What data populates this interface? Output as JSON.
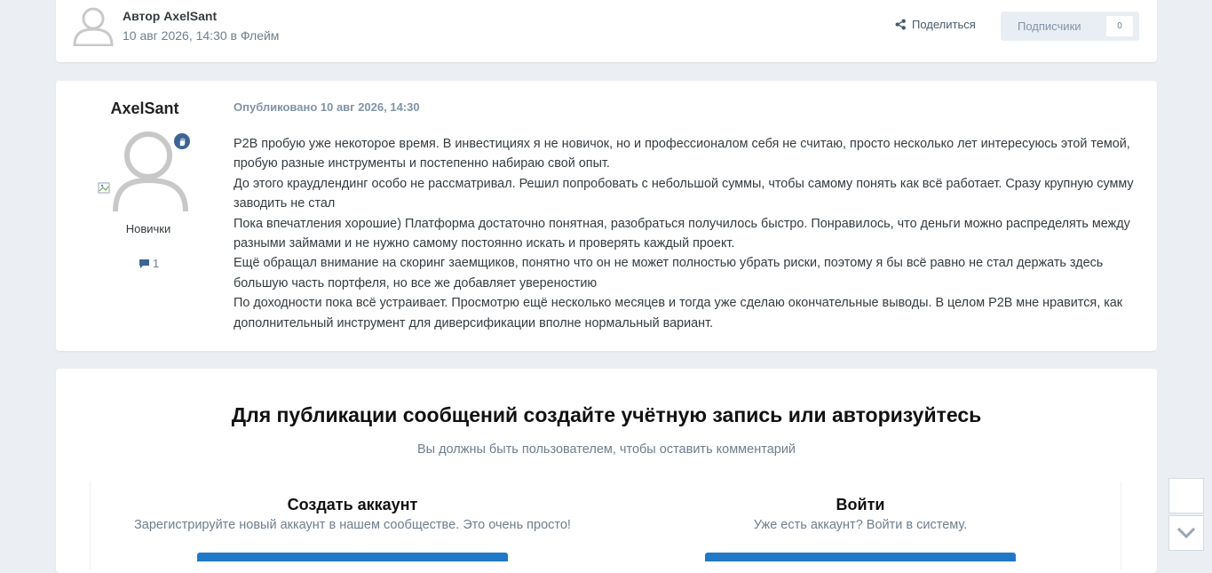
{
  "header": {
    "author_label": "Автор AxelSant",
    "meta": "10 авг 2026, 14:30 в Флейм",
    "share_label": "Поделиться",
    "follow_label": "Подписчики",
    "follow_count": "0",
    "icons": [
      "user-avatar-icon",
      "share-icon"
    ]
  },
  "post": {
    "username": "AxelSant",
    "rank": "Новички",
    "post_count": "1",
    "published": "Опубликовано 10 авг 2026, 14:30",
    "paragraphs": [
      "P2B пробую уже некоторое время. В инвестициях я не новичок, но и профессионалом себя не считаю, просто несколько лет интересуюсь этой темой, пробую разные инструменты и постепенно набираю свой опыт.",
      "До этого краудлендинг особо не рассматривал. Решил попробовать с небольшой суммы, чтобы самому понять как всё работает. Сразу крупную сумму заводить не стал",
      "Пока впечатления хорошие) Платформа достаточно понятная, разобраться получилось быстро. Понравилось, что деньги можно распределять между разными займами и не нужно самому постоянно искать и проверять каждый проект.",
      "Ещё обращал внимание на скоринг заемщиков, понятно что он не может полностью убрать риски, поэтому я бы всё равно не стал держать здесь большую часть портфеля, но все же добавляет увереностию",
      "По доходности пока всё устраивает. Просмотрю ещё несколько месяцев и тогда уже сделаю окончательные выводы. В целом P2B мне нравится, как дополнительный инструмент для диверсификации вполне нормальный вариант."
    ],
    "icons": [
      "user-avatar-icon",
      "hand-badge-icon",
      "comment-icon",
      "broken-image-icon"
    ],
    "accent": "#3d6594"
  },
  "auth": {
    "title": "Для публикации сообщений создайте учётную запись или авторизуйтесь",
    "subtitle": "Вы должны быть пользователем, чтобы оставить комментарий",
    "register": {
      "title": "Создать аккаунт",
      "text": "Зарегистрируйте новый аккаунт в нашем сообществе. Это очень просто!"
    },
    "login": {
      "title": "Войти",
      "text": "Уже есть аккаунт? Войти в систему."
    },
    "button_color": "#2078c8"
  },
  "scroll": {
    "icons": [
      "scroll-up-icon",
      "chevron-down-icon"
    ]
  }
}
